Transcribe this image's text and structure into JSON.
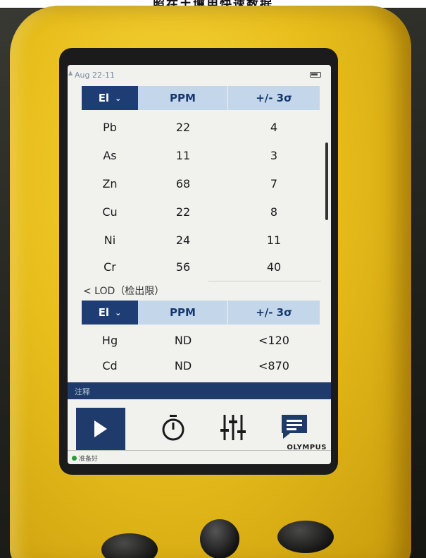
{
  "caption": "照在土壤用快速数据",
  "status": {
    "date": "Aug 22-11"
  },
  "table1": {
    "headers": {
      "el": "El",
      "ppm": "PPM",
      "err": "+/- 3σ"
    },
    "rows": [
      {
        "el": "Pb",
        "ppm": "22",
        "err": "4"
      },
      {
        "el": "As",
        "ppm": "11",
        "err": "3"
      },
      {
        "el": "Zn",
        "ppm": "68",
        "err": "7"
      },
      {
        "el": "Cu",
        "ppm": "22",
        "err": "8"
      },
      {
        "el": "Ni",
        "ppm": "24",
        "err": "11"
      },
      {
        "el": "Cr",
        "ppm": "56",
        "err": "40"
      }
    ]
  },
  "lod_label": "< LOD（检出限）",
  "table2": {
    "headers": {
      "el": "El",
      "ppm": "PPM",
      "err": "+/- 3σ"
    },
    "rows": [
      {
        "el": "Hg",
        "ppm": "ND",
        "err": "<120"
      },
      {
        "el": "Cd",
        "ppm": "ND",
        "err": "<870"
      }
    ]
  },
  "nav_strip_label": "注释",
  "footer": {
    "ready": "准备好",
    "brand": "OLYMPUS"
  },
  "icons": {
    "battery": "battery-icon",
    "play": "play-icon",
    "timer": "timer-icon",
    "sliders": "sliders-icon",
    "chat": "chat-icon"
  },
  "colors": {
    "accent": "#1e3b6b",
    "header": "#c4d6ea",
    "body": "#e8be1c",
    "ready": "#2a9a3a"
  }
}
